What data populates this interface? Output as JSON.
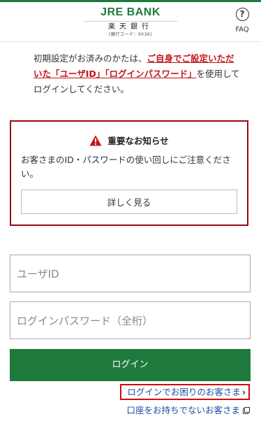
{
  "header": {
    "brand_name": "JRE BANK",
    "brand_kanji": "楽天銀行",
    "brand_code": "(銀行コード：0036)",
    "faq_label": "FAQ",
    "faq_icon": "question-circle-icon",
    "accent_color": "#1e7a3c"
  },
  "intro": {
    "prefix": "初期設定がお済みのかたは、",
    "link": "ご自身でご設定いただいた「ユーザID」「ログインパスワード」",
    "suffix": "を使用してログインしてください。"
  },
  "notice": {
    "title": "重要なお知らせ",
    "icon": "warning-icon",
    "body": "お客さまのID・パスワードの使い回しにご注意ください。",
    "button": "詳しく見る"
  },
  "form": {
    "user_placeholder": "ユーザID",
    "password_placeholder": "ログインパスワード（全桁）",
    "login_button": "ログイン"
  },
  "links": {
    "help": "ログインでお困りのお客さま",
    "help_icon": "chevron-right-icon",
    "no_account": "口座をお持ちでないお客さま",
    "no_account_icon": "external-link-icon"
  }
}
